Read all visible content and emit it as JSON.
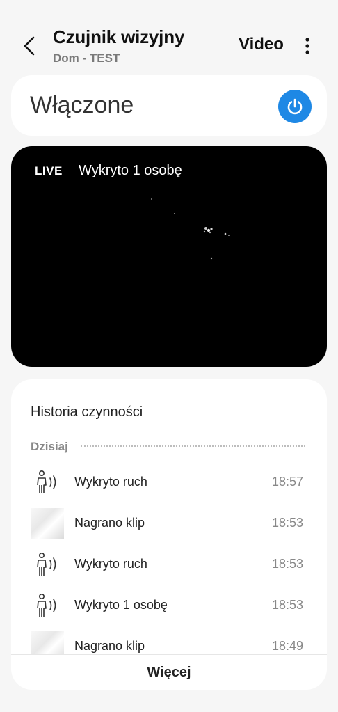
{
  "header": {
    "title": "Czujnik wizyjny",
    "subtitle": "Dom - TEST",
    "video_label": "Video",
    "icons": {
      "back": "chevron-left-icon",
      "more": "more-vertical-icon"
    }
  },
  "power": {
    "status_label": "Włączone",
    "button_icon": "power-icon",
    "accent_color": "#1e88e5"
  },
  "video": {
    "live_label": "LIVE",
    "detection_label": "Wykryto 1 osobę"
  },
  "history": {
    "title": "Historia czynności",
    "section_label": "Dzisiaj",
    "items": [
      {
        "icon": "motion-person-icon",
        "label": "Wykryto ruch",
        "time": "18:57"
      },
      {
        "icon": "clip-thumbnail",
        "label": "Nagrano klip",
        "time": "18:53"
      },
      {
        "icon": "motion-person-icon",
        "label": "Wykryto ruch",
        "time": "18:53"
      },
      {
        "icon": "motion-person-icon",
        "label": "Wykryto 1 osobę",
        "time": "18:53"
      },
      {
        "icon": "clip-thumbnail",
        "label": "Nagrano klip",
        "time": "18:49"
      }
    ],
    "more_label": "Więcej"
  }
}
